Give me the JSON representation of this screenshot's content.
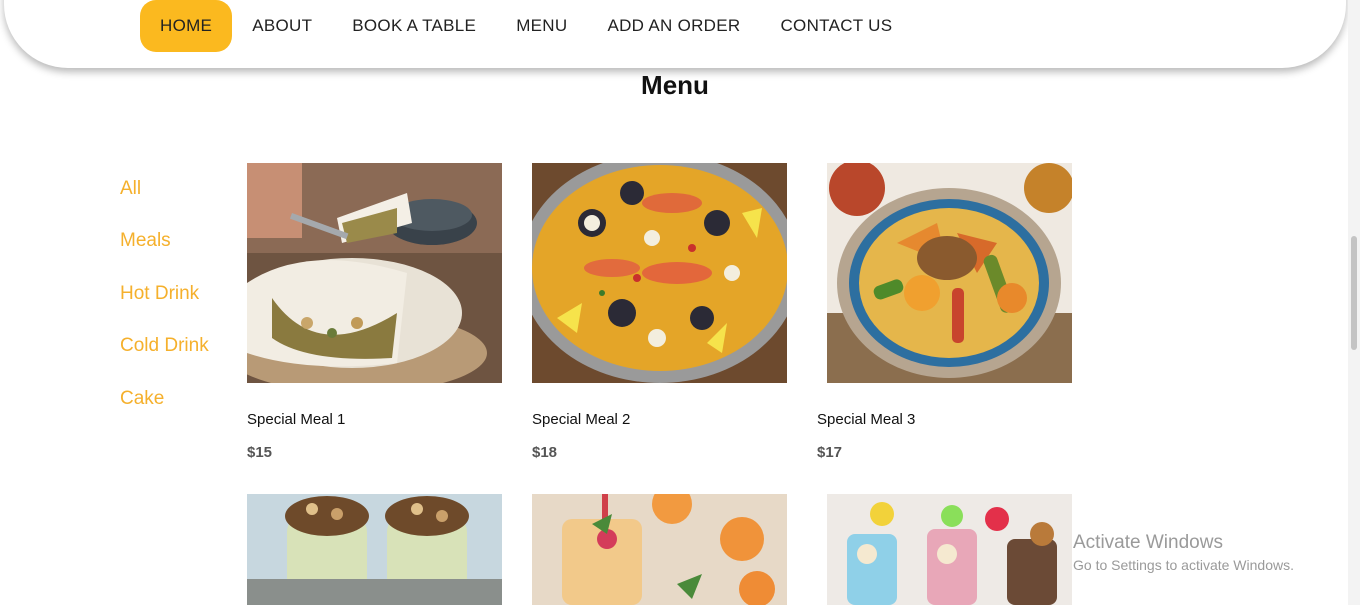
{
  "nav": {
    "items": [
      {
        "label": "HOME",
        "active": true
      },
      {
        "label": "ABOUT"
      },
      {
        "label": "BOOK A TABLE"
      },
      {
        "label": "MENU"
      },
      {
        "label": "ADD AN ORDER"
      },
      {
        "label": "CONTACT US"
      }
    ],
    "active_color": "#fbb91f"
  },
  "page": {
    "title": "Menu"
  },
  "categories": [
    "All",
    "Meals",
    "Hot Drink",
    "Cold Drink",
    "Cake"
  ],
  "category_color": "#f5b02c",
  "items": [
    {
      "name": "Special Meal 1",
      "price": "$15",
      "image": "pastilla-pie-photo"
    },
    {
      "name": "Special Meal 2",
      "price": "$18",
      "image": "paella-photo"
    },
    {
      "name": "Special Meal 3",
      "price": "$17",
      "image": "couscous-photo"
    },
    {
      "image": "nut-dessert-cups-photo"
    },
    {
      "image": "smoothie-drink-photo"
    },
    {
      "image": "milkshakes-photo"
    }
  ],
  "watermark": {
    "title": "Activate Windows",
    "subtitle": "Go to Settings to activate Windows."
  }
}
